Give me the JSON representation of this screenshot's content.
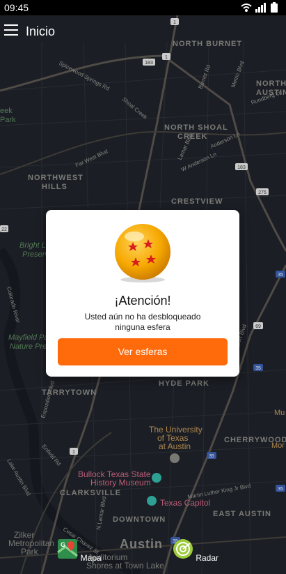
{
  "status": {
    "time": "09:45"
  },
  "appbar": {
    "title": "Inicio"
  },
  "map": {
    "areas": [
      "NORTH BURNET",
      "NORTH AUSTIN",
      "NORTH SHOAL",
      "CREEK",
      "NORTHWEST",
      "HILLS",
      "CRESTVIEW",
      "HYDE PARK",
      "TARRYTOWN",
      "CHERRYWOOD",
      "CLARKSVILLE",
      "DOWNTOWN",
      "EAST AUSTIN",
      "Austin"
    ],
    "parks": [
      "Bright Leaf",
      "Preserve",
      "Mayfield Park",
      "Nature Pre"
    ],
    "places": [
      "The University",
      "of Texas",
      "at Austin",
      "Bullock Texas State",
      "History Museum",
      "Texas Capitol",
      "Zilker",
      "Metropolitan",
      "Park",
      "Auditorium",
      "Shores at Town Lake"
    ],
    "roads": [
      "Spicewood Springs Rd",
      "Shoal Creek",
      "Far West Blvd",
      "W Anderson Ln",
      "Burnet Rd",
      "Metric Blvd",
      "Rundberg Ln",
      "Anderson Ln",
      "Lamar Blvd",
      "Colorado River",
      "Exposition Blvd",
      "Enfield Rd",
      "Lake Austin Blvd",
      "Airport Blvd",
      "Martin Luther King Jr Blvd",
      "N Lamar Blvd",
      "Cesar Chavez St"
    ],
    "shields": [
      "1",
      "183",
      "1",
      "183",
      "275",
      "35",
      "35",
      "69",
      "1",
      "35",
      "35",
      "35"
    ],
    "edge_labels": [
      "Park",
      "eek",
      "22",
      "River",
      "Mu",
      "Mor",
      "ORTH",
      "AUSTIN",
      "US"
    ]
  },
  "dialog": {
    "title": "¡Atención!",
    "message_line1": "Usted aún no ha desbloqueado",
    "message_line2": "ninguna esfera",
    "button": "Ver esferas"
  },
  "bottom_nav": [
    {
      "label": "Mapa",
      "icon": "map-icon"
    },
    {
      "label": "Radar",
      "icon": "radar-icon"
    }
  ],
  "colors": {
    "accent": "#ff6a0a",
    "map_bg": "#1f2329",
    "ball": "#f6a800",
    "star": "#d81e1e"
  }
}
